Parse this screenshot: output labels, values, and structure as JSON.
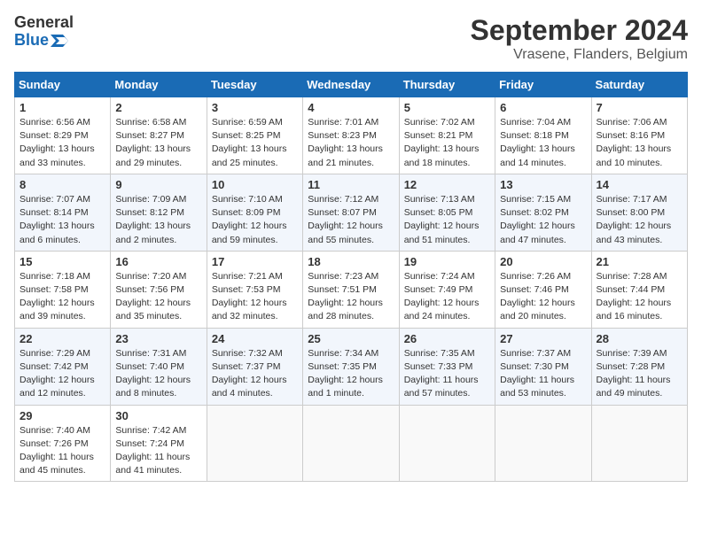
{
  "header": {
    "logo_line1": "General",
    "logo_line2": "Blue",
    "month_year": "September 2024",
    "location": "Vrasene, Flanders, Belgium"
  },
  "columns": [
    "Sunday",
    "Monday",
    "Tuesday",
    "Wednesday",
    "Thursday",
    "Friday",
    "Saturday"
  ],
  "weeks": [
    [
      {
        "day": "1",
        "info": "Sunrise: 6:56 AM\nSunset: 8:29 PM\nDaylight: 13 hours\nand 33 minutes."
      },
      {
        "day": "2",
        "info": "Sunrise: 6:58 AM\nSunset: 8:27 PM\nDaylight: 13 hours\nand 29 minutes."
      },
      {
        "day": "3",
        "info": "Sunrise: 6:59 AM\nSunset: 8:25 PM\nDaylight: 13 hours\nand 25 minutes."
      },
      {
        "day": "4",
        "info": "Sunrise: 7:01 AM\nSunset: 8:23 PM\nDaylight: 13 hours\nand 21 minutes."
      },
      {
        "day": "5",
        "info": "Sunrise: 7:02 AM\nSunset: 8:21 PM\nDaylight: 13 hours\nand 18 minutes."
      },
      {
        "day": "6",
        "info": "Sunrise: 7:04 AM\nSunset: 8:18 PM\nDaylight: 13 hours\nand 14 minutes."
      },
      {
        "day": "7",
        "info": "Sunrise: 7:06 AM\nSunset: 8:16 PM\nDaylight: 13 hours\nand 10 minutes."
      }
    ],
    [
      {
        "day": "8",
        "info": "Sunrise: 7:07 AM\nSunset: 8:14 PM\nDaylight: 13 hours\nand 6 minutes."
      },
      {
        "day": "9",
        "info": "Sunrise: 7:09 AM\nSunset: 8:12 PM\nDaylight: 13 hours\nand 2 minutes."
      },
      {
        "day": "10",
        "info": "Sunrise: 7:10 AM\nSunset: 8:09 PM\nDaylight: 12 hours\nand 59 minutes."
      },
      {
        "day": "11",
        "info": "Sunrise: 7:12 AM\nSunset: 8:07 PM\nDaylight: 12 hours\nand 55 minutes."
      },
      {
        "day": "12",
        "info": "Sunrise: 7:13 AM\nSunset: 8:05 PM\nDaylight: 12 hours\nand 51 minutes."
      },
      {
        "day": "13",
        "info": "Sunrise: 7:15 AM\nSunset: 8:02 PM\nDaylight: 12 hours\nand 47 minutes."
      },
      {
        "day": "14",
        "info": "Sunrise: 7:17 AM\nSunset: 8:00 PM\nDaylight: 12 hours\nand 43 minutes."
      }
    ],
    [
      {
        "day": "15",
        "info": "Sunrise: 7:18 AM\nSunset: 7:58 PM\nDaylight: 12 hours\nand 39 minutes."
      },
      {
        "day": "16",
        "info": "Sunrise: 7:20 AM\nSunset: 7:56 PM\nDaylight: 12 hours\nand 35 minutes."
      },
      {
        "day": "17",
        "info": "Sunrise: 7:21 AM\nSunset: 7:53 PM\nDaylight: 12 hours\nand 32 minutes."
      },
      {
        "day": "18",
        "info": "Sunrise: 7:23 AM\nSunset: 7:51 PM\nDaylight: 12 hours\nand 28 minutes."
      },
      {
        "day": "19",
        "info": "Sunrise: 7:24 AM\nSunset: 7:49 PM\nDaylight: 12 hours\nand 24 minutes."
      },
      {
        "day": "20",
        "info": "Sunrise: 7:26 AM\nSunset: 7:46 PM\nDaylight: 12 hours\nand 20 minutes."
      },
      {
        "day": "21",
        "info": "Sunrise: 7:28 AM\nSunset: 7:44 PM\nDaylight: 12 hours\nand 16 minutes."
      }
    ],
    [
      {
        "day": "22",
        "info": "Sunrise: 7:29 AM\nSunset: 7:42 PM\nDaylight: 12 hours\nand 12 minutes."
      },
      {
        "day": "23",
        "info": "Sunrise: 7:31 AM\nSunset: 7:40 PM\nDaylight: 12 hours\nand 8 minutes."
      },
      {
        "day": "24",
        "info": "Sunrise: 7:32 AM\nSunset: 7:37 PM\nDaylight: 12 hours\nand 4 minutes."
      },
      {
        "day": "25",
        "info": "Sunrise: 7:34 AM\nSunset: 7:35 PM\nDaylight: 12 hours\nand 1 minute."
      },
      {
        "day": "26",
        "info": "Sunrise: 7:35 AM\nSunset: 7:33 PM\nDaylight: 11 hours\nand 57 minutes."
      },
      {
        "day": "27",
        "info": "Sunrise: 7:37 AM\nSunset: 7:30 PM\nDaylight: 11 hours\nand 53 minutes."
      },
      {
        "day": "28",
        "info": "Sunrise: 7:39 AM\nSunset: 7:28 PM\nDaylight: 11 hours\nand 49 minutes."
      }
    ],
    [
      {
        "day": "29",
        "info": "Sunrise: 7:40 AM\nSunset: 7:26 PM\nDaylight: 11 hours\nand 45 minutes."
      },
      {
        "day": "30",
        "info": "Sunrise: 7:42 AM\nSunset: 7:24 PM\nDaylight: 11 hours\nand 41 minutes."
      },
      {
        "day": "",
        "info": ""
      },
      {
        "day": "",
        "info": ""
      },
      {
        "day": "",
        "info": ""
      },
      {
        "day": "",
        "info": ""
      },
      {
        "day": "",
        "info": ""
      }
    ]
  ]
}
